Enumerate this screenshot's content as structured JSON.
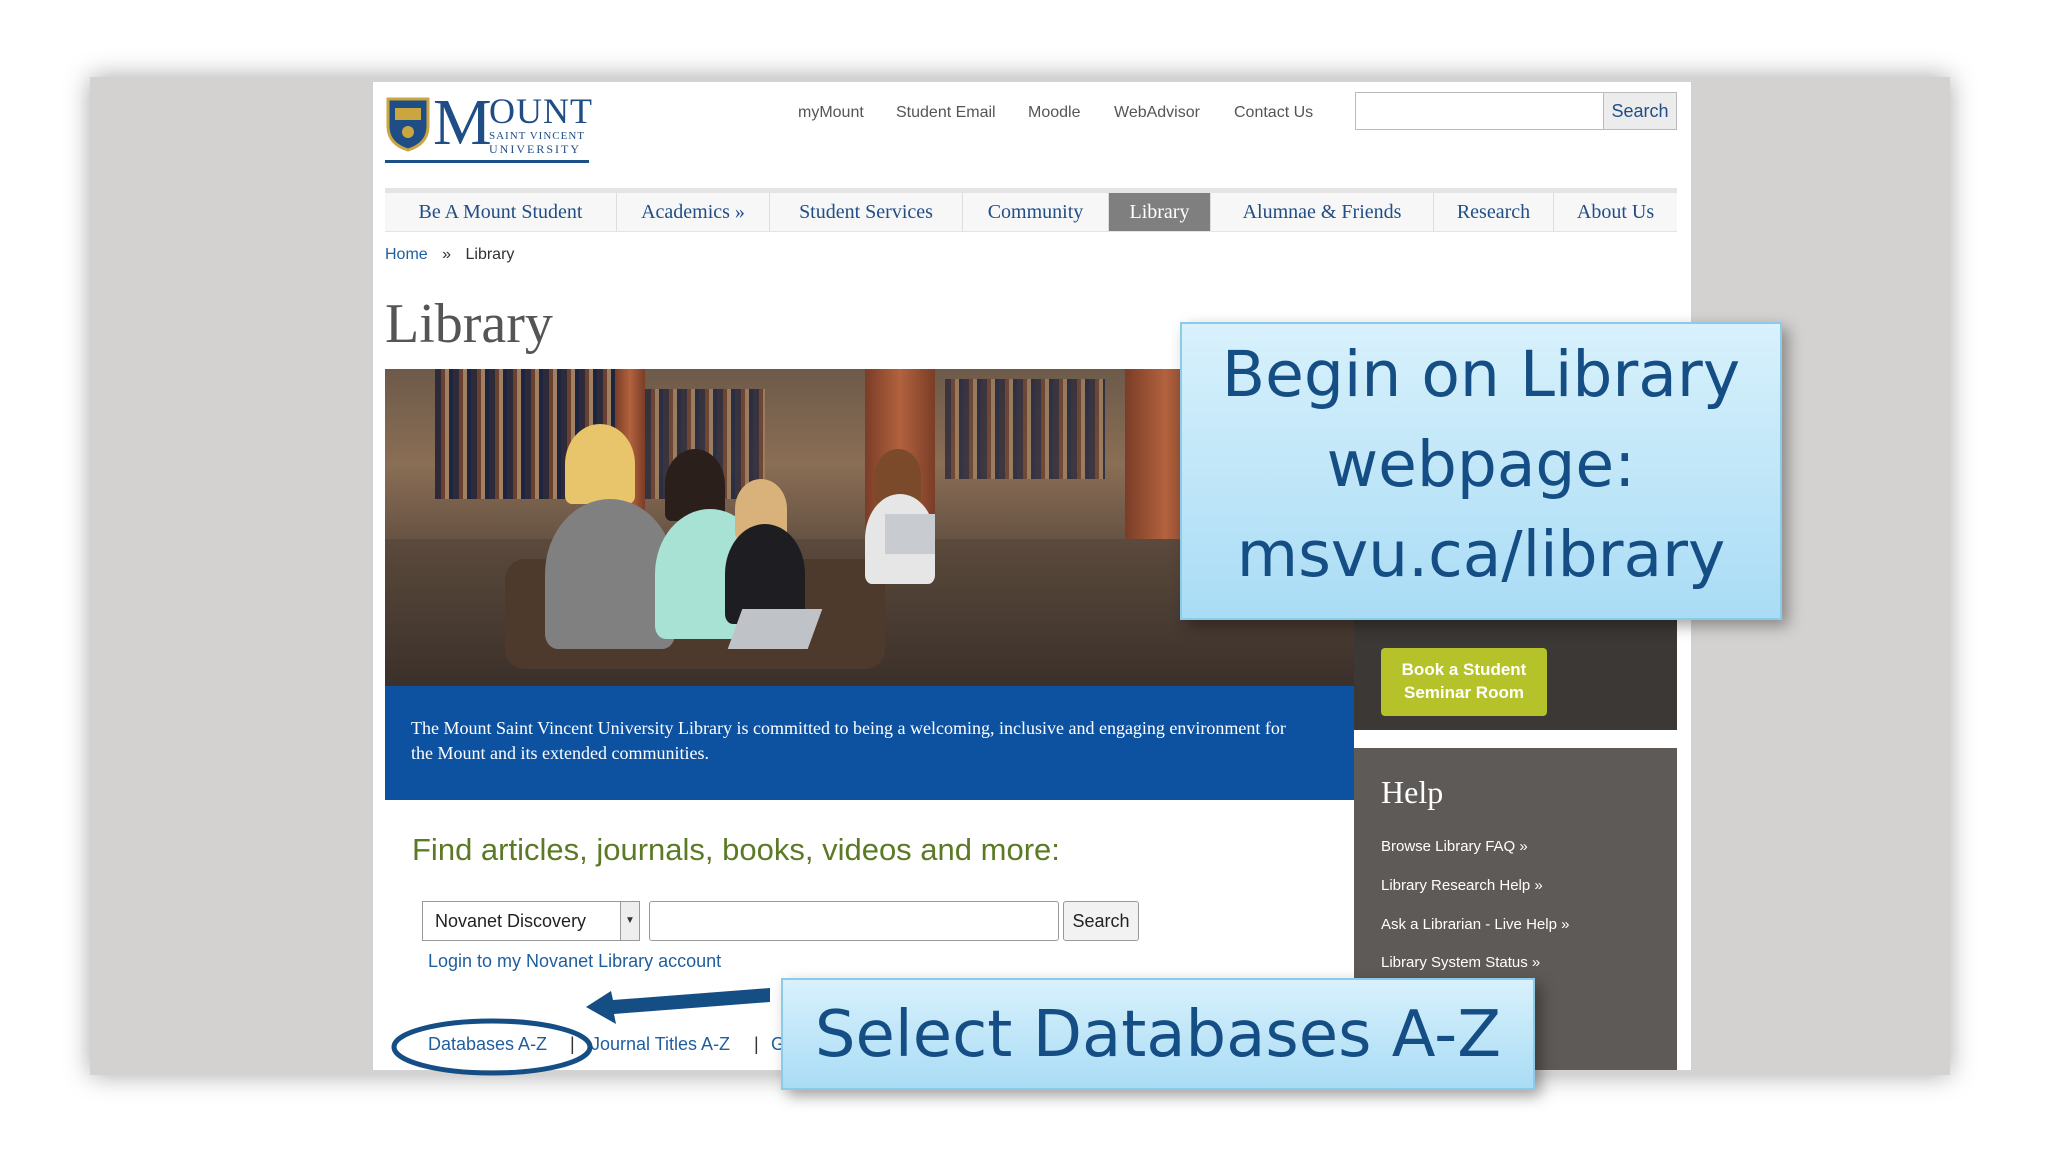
{
  "logo": {
    "main": "M",
    "ount": "OUNT",
    "sub1": "SAINT VINCENT",
    "sub2": "UNIVERSITY"
  },
  "util_links": [
    "myMount",
    "Student Email",
    "Moodle",
    "WebAdvisor",
    "Contact Us"
  ],
  "top_search": {
    "button": "Search",
    "value": ""
  },
  "nav": [
    "Be A Mount Student",
    "Academics »",
    "Student Services",
    "Community",
    "Library",
    "Alumnae & Friends",
    "Research",
    "About Us"
  ],
  "nav_active": "Library",
  "breadcrumb": {
    "home": "Home",
    "sep": "»",
    "current": "Library"
  },
  "page_title": "Library",
  "hero_caption": "The Mount Saint Vincent University Library is committed to being a welcoming, inclusive and engaging environment for the Mount and its extended communities.",
  "sidebar": {
    "book_button": "Book a Student Seminar Room",
    "help_title": "Help",
    "help_links": [
      "Browse Library FAQ »",
      "Library Research Help »",
      "Ask a Librarian - Live Help »",
      "Library System Status »"
    ]
  },
  "find": {
    "heading": "Find articles, journals, books, videos and more:",
    "select_value": "Novanet Discovery",
    "input_value": "",
    "button": "Search",
    "login_link": "Login to my Novanet Library account"
  },
  "bottom_links": {
    "databases": "Databases A-Z",
    "sep": "|",
    "journals": "Journal Titles A-Z",
    "sep2": "|",
    "more": "G"
  },
  "callouts": {
    "begin": [
      "Begin on Library",
      "webpage:",
      "msvu.ca/library"
    ],
    "select": "Select Databases A-Z"
  },
  "colors": {
    "brand": "#1f4d86",
    "caption_bg": "#0d52a0",
    "book_btn": "#b5c22a",
    "callout_text": "#154e84",
    "find_heading": "#5c7a26"
  }
}
